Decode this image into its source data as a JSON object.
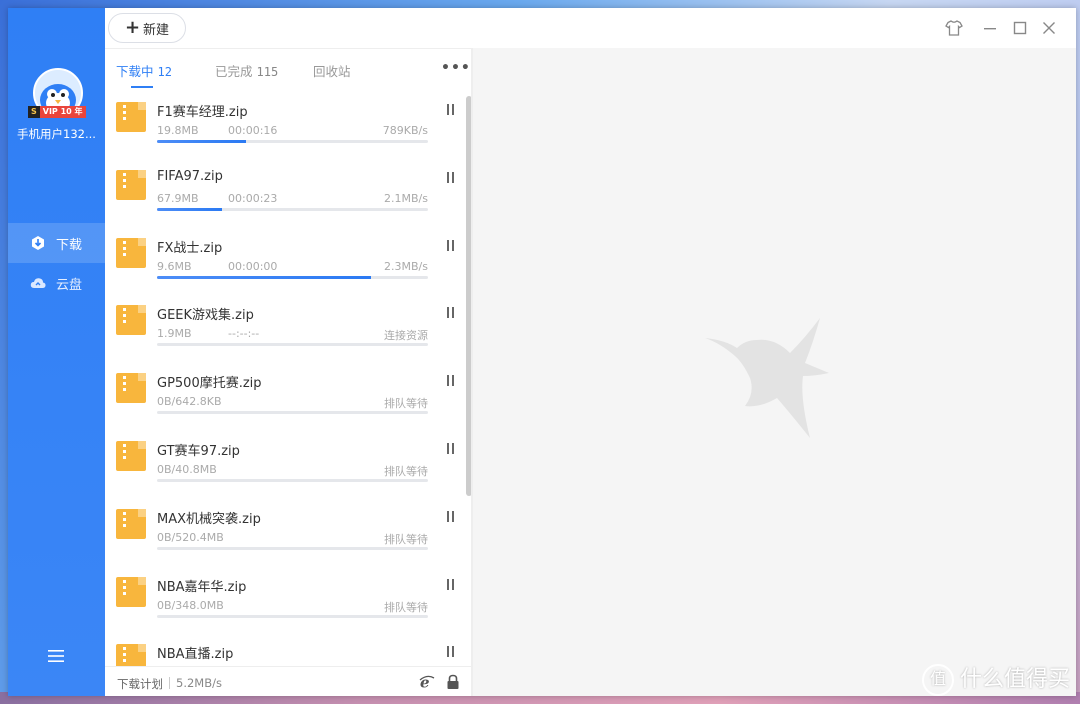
{
  "sidebar": {
    "vip_s": "S",
    "vip_label": "VIP 10 年",
    "username": "手机用户132...",
    "nav": [
      {
        "label": "下载",
        "icon": "download-icon",
        "active": true
      },
      {
        "label": "云盘",
        "icon": "cloud-icon",
        "active": false
      }
    ]
  },
  "toolbar": {
    "new_label": "新建"
  },
  "tabs": [
    {
      "label": "下载中",
      "count": "12",
      "active": true
    },
    {
      "label": "已完成",
      "count": "115",
      "active": false
    },
    {
      "label": "回收站",
      "count": "",
      "active": false
    }
  ],
  "downloads": [
    {
      "name": "F1赛车经理.zip",
      "size": "19.8MB",
      "time": "00:00:16",
      "status": "789KB/s",
      "progress": 0.33
    },
    {
      "name": "FIFA97.zip",
      "size": "67.9MB",
      "time": "00:00:23",
      "status": "2.1MB/s",
      "progress": 0.24
    },
    {
      "name": "FX战士.zip",
      "size": "9.6MB",
      "time": "00:00:00",
      "status": "2.3MB/s",
      "progress": 0.79
    },
    {
      "name": "GEEK游戏集.zip",
      "size": "1.9MB",
      "time": "--:--:--",
      "status": "连接资源",
      "progress": 0
    },
    {
      "name": "GP500摩托赛.zip",
      "size": "0B/642.8KB",
      "time": "",
      "status": "排队等待",
      "progress": 0
    },
    {
      "name": "GT赛车97.zip",
      "size": "0B/40.8MB",
      "time": "",
      "status": "排队等待",
      "progress": 0
    },
    {
      "name": "MAX机械突袭.zip",
      "size": "0B/520.4MB",
      "time": "",
      "status": "排队等待",
      "progress": 0
    },
    {
      "name": "NBA嘉年华.zip",
      "size": "0B/348.0MB",
      "time": "",
      "status": "排队等待",
      "progress": 0
    },
    {
      "name": "NBA直播.zip",
      "size": "",
      "time": "",
      "status": "",
      "progress": 0
    }
  ],
  "footer": {
    "plan_label": "下载计划",
    "total_speed": "5.2MB/s"
  },
  "watermark": {
    "logo": "值",
    "text": "什么值得买"
  },
  "colors": {
    "accent": "#2f7ff5",
    "folder": "#f8b63d"
  }
}
